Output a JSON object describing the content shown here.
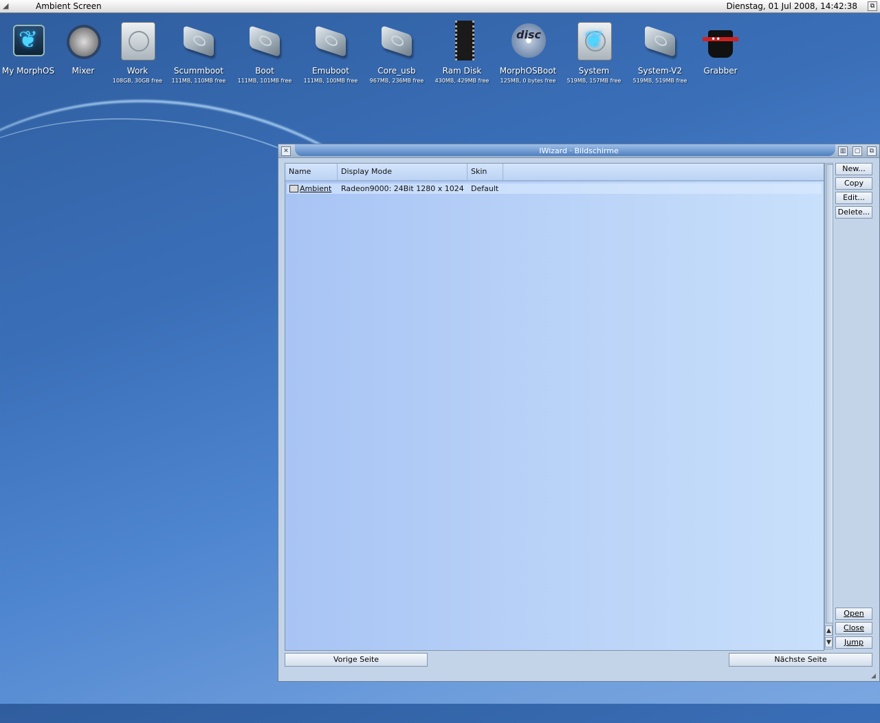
{
  "topbar": {
    "title": "Ambient Screen",
    "clock": "Dienstag, 01 Jul 2008, 14:42:38"
  },
  "desktop_icons": [
    {
      "label": "My MorphOS",
      "sub": ""
    },
    {
      "label": "Mixer",
      "sub": ""
    },
    {
      "label": "Work",
      "sub": "108GB, 30GB free"
    },
    {
      "label": "Scummboot",
      "sub": "111MB, 110MB free"
    },
    {
      "label": "Boot",
      "sub": "111MB, 101MB free"
    },
    {
      "label": "Emuboot",
      "sub": "111MB, 100MB free"
    },
    {
      "label": "Core_usb",
      "sub": "967MB, 236MB free"
    },
    {
      "label": "Ram Disk",
      "sub": "430MB, 429MB free"
    },
    {
      "label": "MorphOSBoot",
      "sub": "125MB, 0 bytes free"
    },
    {
      "label": "System",
      "sub": "519MB, 157MB free"
    },
    {
      "label": "System-V2",
      "sub": "519MB, 519MB free"
    },
    {
      "label": "Grabber",
      "sub": ""
    }
  ],
  "icon_glyph_text": {
    "disc": "disc"
  },
  "window": {
    "title": "IWizard · Bildschirme",
    "columns": [
      "Name",
      "Display Mode",
      "Skin"
    ],
    "rows": [
      {
        "name": "Ambient",
        "mode": "Radeon9000: 24Bit 1280 x 1024",
        "skin": "Default"
      }
    ],
    "side_buttons_top": [
      "New...",
      "Copy",
      "Edit...",
      "Delete..."
    ],
    "side_buttons_bottom": [
      "Open",
      "Close",
      "Jump"
    ],
    "prev_label": "Vorige Seite",
    "next_label": "Nächste Seite"
  },
  "colors": {
    "desktop": "#3a6fb8",
    "list_bg": "#a8c4f4",
    "title_tab": "#4f7fbf"
  },
  "icons": {
    "menu": "amiga-menu-icon",
    "depth": "depth-gadget-icon",
    "close": "close-icon",
    "screen": "screen-icon",
    "arrow_up": "arrow-up-icon",
    "arrow_down": "arrow-down-icon"
  }
}
